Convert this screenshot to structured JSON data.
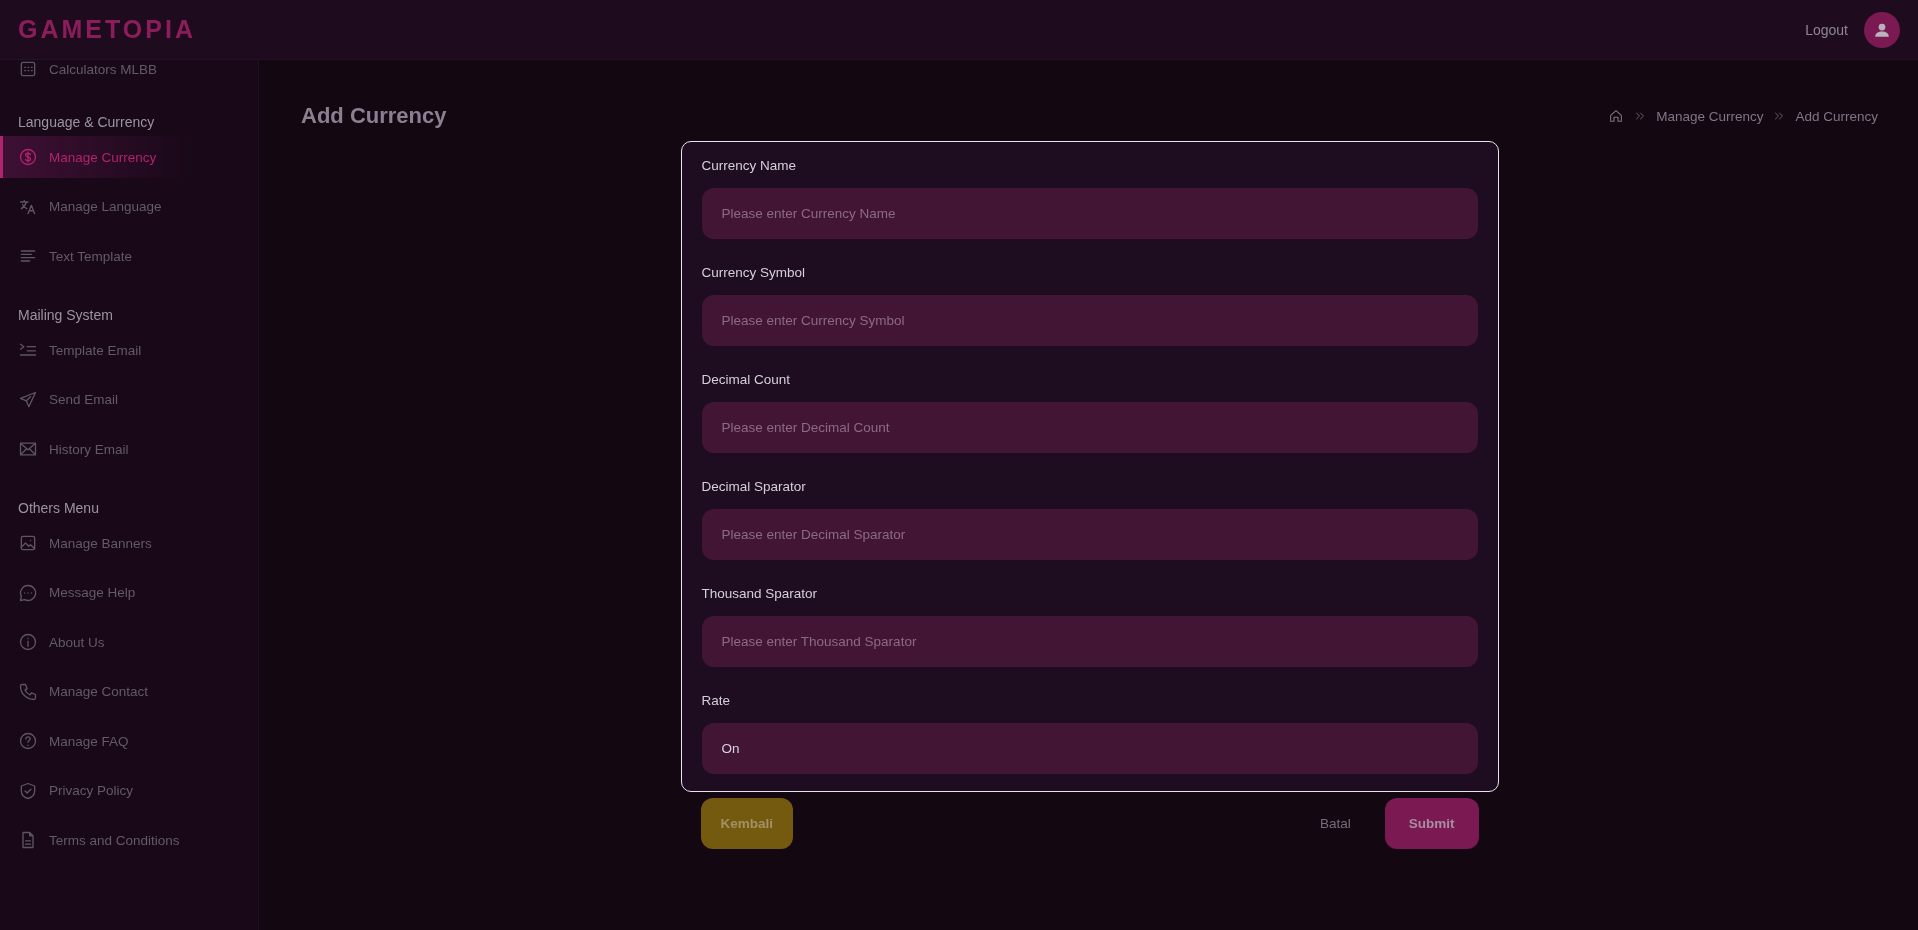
{
  "header": {
    "logo": "GAMETOPIA",
    "logout": "Logout"
  },
  "sidebar": {
    "sections": [
      {
        "items": [
          {
            "label": "Calculators MLBB",
            "kind": "calculator",
            "selected": false
          }
        ]
      },
      {
        "title": "Language & Currency",
        "items": [
          {
            "label": "Manage Currency",
            "kind": "dollar",
            "selected": true
          },
          {
            "label": "Manage Language",
            "kind": "translate",
            "selected": false
          },
          {
            "label": "Text Template",
            "kind": "lines",
            "selected": false
          }
        ]
      },
      {
        "title": "Mailing System",
        "items": [
          {
            "label": "Template Email",
            "kind": "list",
            "selected": false
          },
          {
            "label": "Send Email",
            "kind": "send",
            "selected": false
          },
          {
            "label": "History Email",
            "kind": "mail",
            "selected": false
          }
        ]
      },
      {
        "title": "Others Menu",
        "items": [
          {
            "label": "Manage Banners",
            "kind": "image",
            "selected": false
          },
          {
            "label": "Message Help",
            "kind": "chat",
            "selected": false
          },
          {
            "label": "About Us",
            "kind": "info",
            "selected": false
          },
          {
            "label": "Manage Contact",
            "kind": "phone",
            "selected": false
          },
          {
            "label": "Manage FAQ",
            "kind": "help",
            "selected": false
          },
          {
            "label": "Privacy Policy",
            "kind": "shield",
            "selected": false
          },
          {
            "label": "Terms and Conditions",
            "kind": "file",
            "selected": false
          }
        ]
      }
    ]
  },
  "page": {
    "title": "Add Currency",
    "breadcrumb": [
      "Manage Currency",
      "Add Currency"
    ]
  },
  "form": {
    "fields": [
      {
        "label": "Currency Name",
        "placeholder": "Please enter Currency Name"
      },
      {
        "label": "Currency Symbol",
        "placeholder": "Please enter Currency Symbol"
      },
      {
        "label": "Decimal Count",
        "placeholder": "Please enter Decimal Count"
      },
      {
        "label": "Decimal Sparator",
        "placeholder": "Please enter Decimal Sparator"
      },
      {
        "label": "Thousand Sparator",
        "placeholder": "Please enter Thousand Sparator"
      },
      {
        "label": "Rate",
        "value": "On"
      }
    ]
  },
  "buttons": {
    "back": "Kembali",
    "cancel": "Batal",
    "submit": "Submit"
  }
}
